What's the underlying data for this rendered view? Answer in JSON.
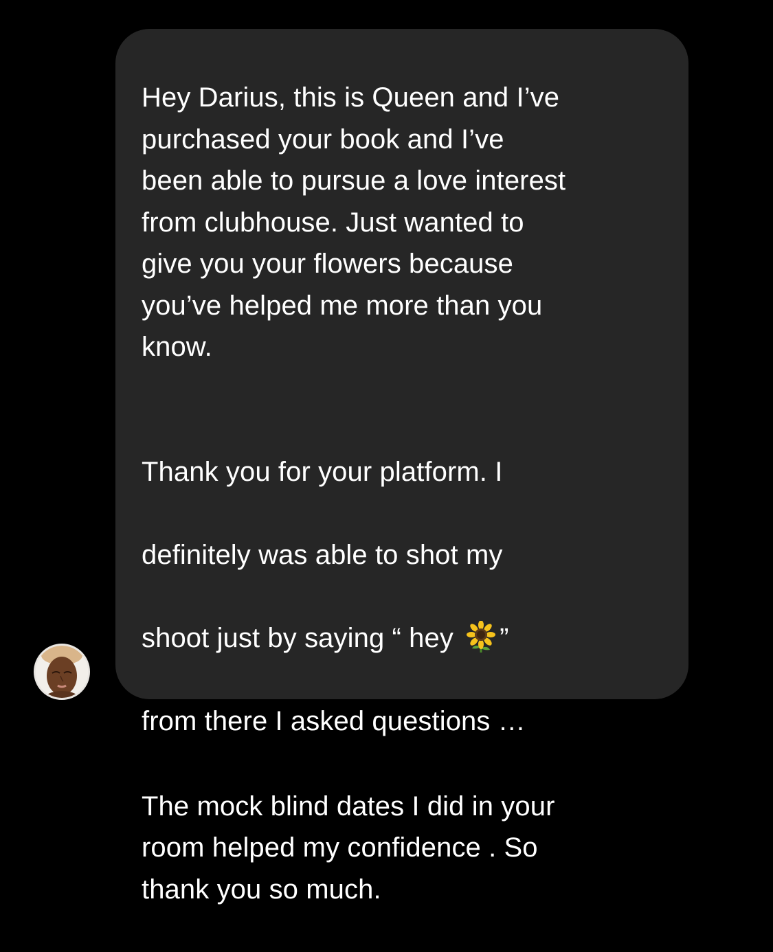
{
  "message": {
    "paragraph_1": "Hey Darius, this is Queen and I’ve\npurchased your book and I’ve\nbeen able to pursue a love interest\nfrom clubhouse. Just wanted to\ngive you your flowers because\nyou’ve helped me more than you\nknow.",
    "paragraph_2_line_1": "Thank you for your platform. I",
    "paragraph_2_line_2": "definitely was able to shot my",
    "paragraph_2_line_3_before": "shoot just by saying “ hey ",
    "paragraph_2_line_3_after": "”",
    "paragraph_2_line_4": "from there I asked questions …",
    "paragraph_2_rest": "The mock blind dates I did in your\nroom helped my confidence . So\nthank you so much.",
    "emoji": "sunflower"
  },
  "sender": {
    "avatar": "profile-photo"
  },
  "colors": {
    "background": "#000000",
    "bubble": "#262626",
    "text": "#ffffff"
  }
}
